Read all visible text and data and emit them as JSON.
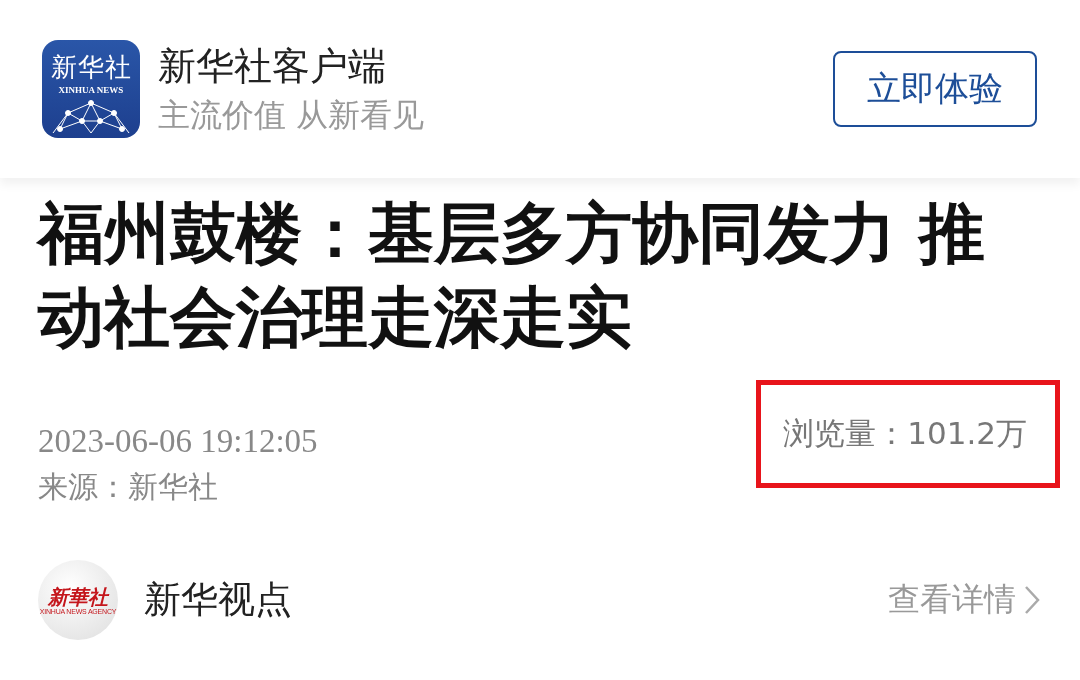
{
  "app_banner": {
    "logo_text": "新华社",
    "logo_subtext": "XINHUA NEWS",
    "name": "新华社客户端",
    "slogan": "主流价值 从新看见",
    "button": "立即体验"
  },
  "article": {
    "title": "福州鼓楼：基层多方协同发力 推动社会治理走深走实",
    "datetime": "2023-06-06 19:12:05",
    "source": "来源：新华社",
    "views": "浏览量：101.2万",
    "views_highlighted": true
  },
  "author": {
    "avatar_text": "新華社",
    "avatar_subtext": "XINHUA NEWS AGENCY",
    "name": "新华视点",
    "link": "查看详情"
  }
}
